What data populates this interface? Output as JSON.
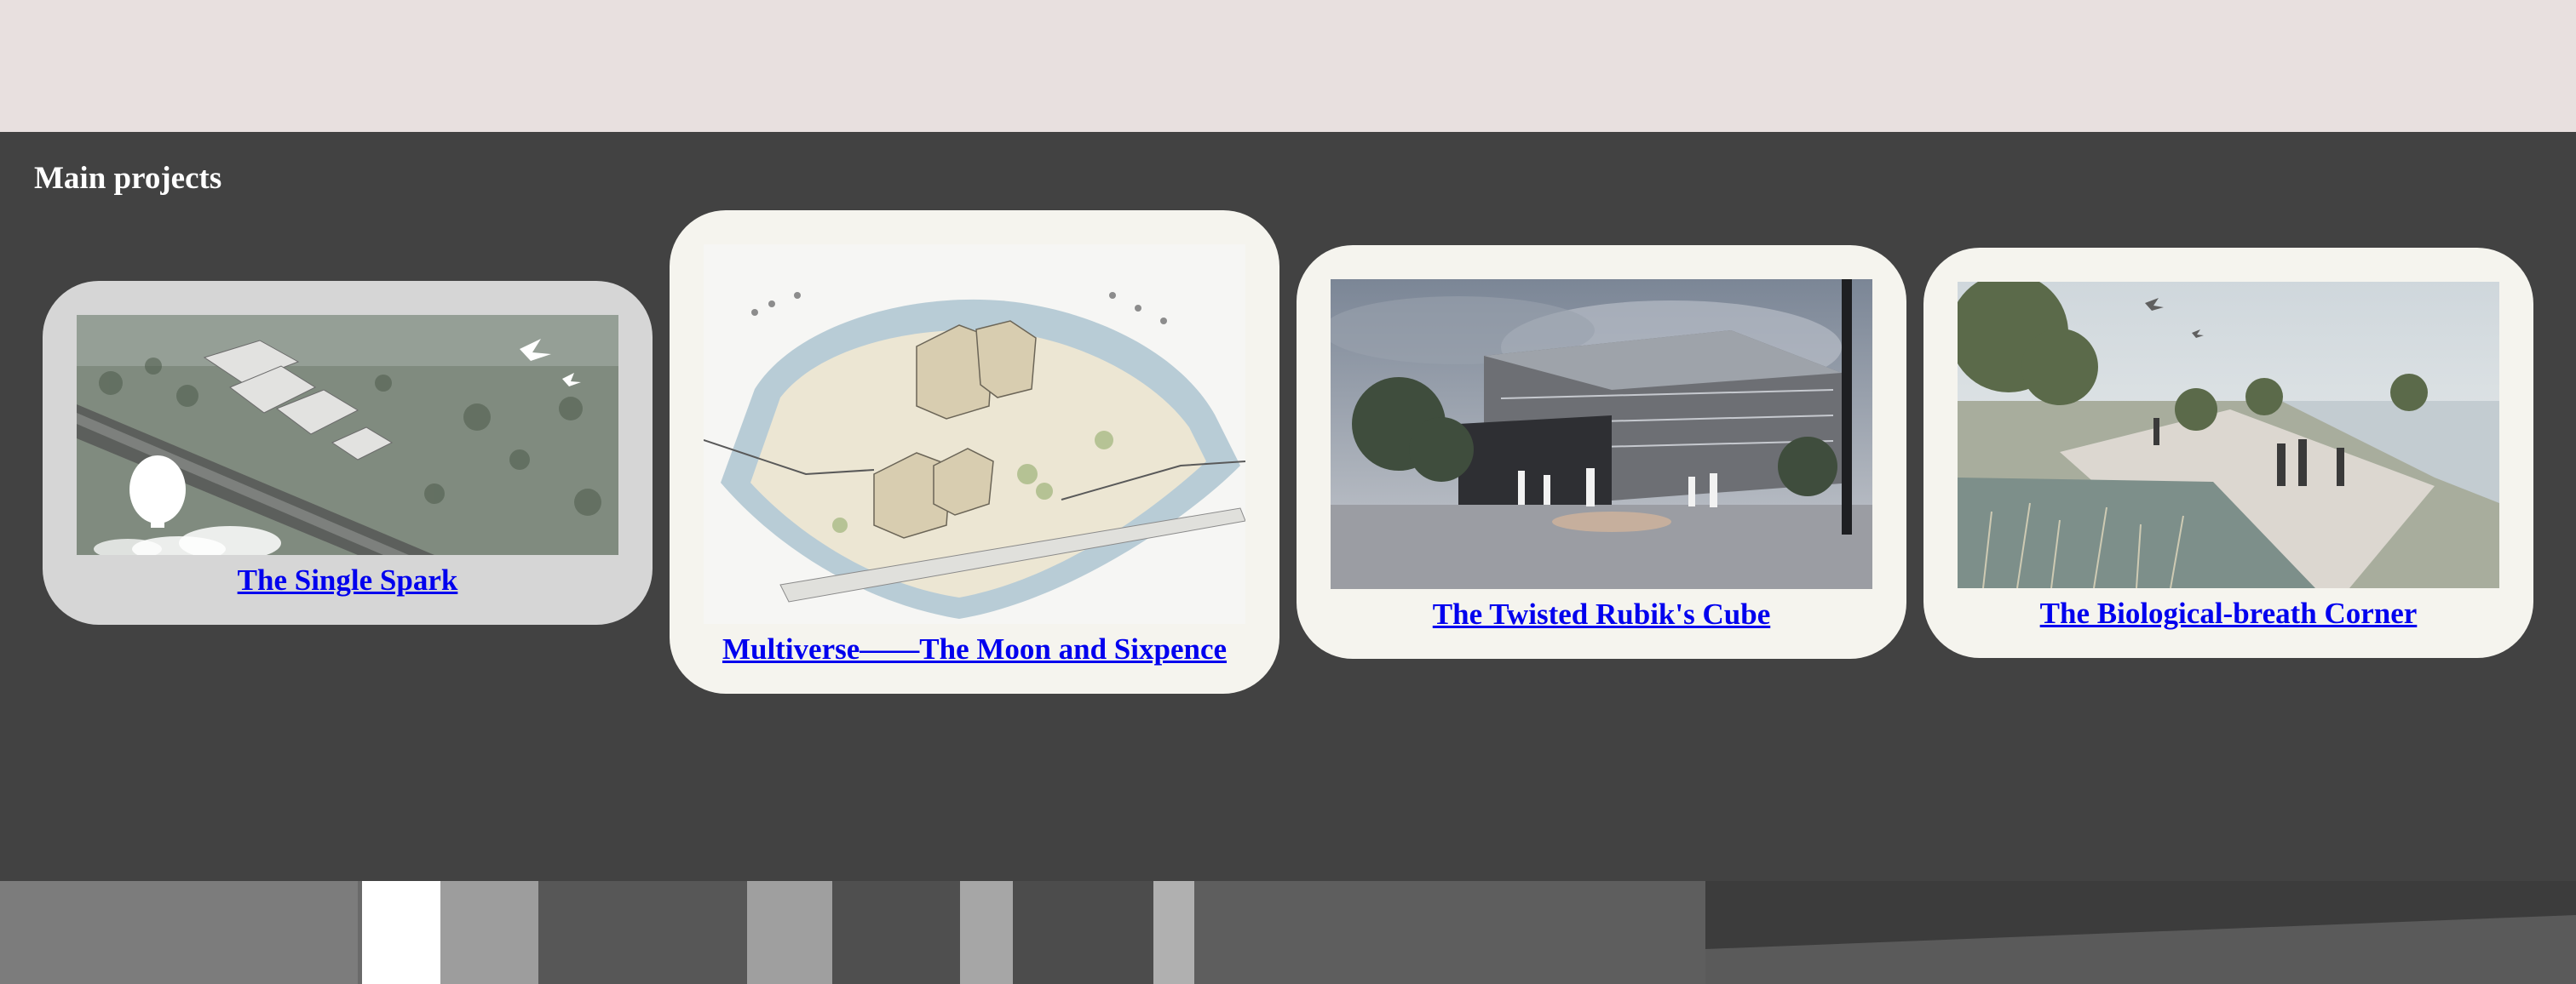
{
  "section": {
    "title": "Main projects"
  },
  "projects": [
    {
      "title": "The Single Spark",
      "image": "aerial-site-plan-rendering"
    },
    {
      "title": "Multiverse——The Moon and Sixpence",
      "image": "axonometric-island-rendering"
    },
    {
      "title": "The Twisted Rubik's Cube",
      "image": "building-exterior-rendering"
    },
    {
      "title": "The Biological-breath Corner",
      "image": "waterfront-park-rendering"
    }
  ],
  "colors": {
    "page_background": "#e8e0df",
    "section_background": "#424242",
    "card_grey": "#d6d6d6",
    "card_cream": "#f5f4ee",
    "link": "#0000ee",
    "title_text": "#ffffff"
  }
}
